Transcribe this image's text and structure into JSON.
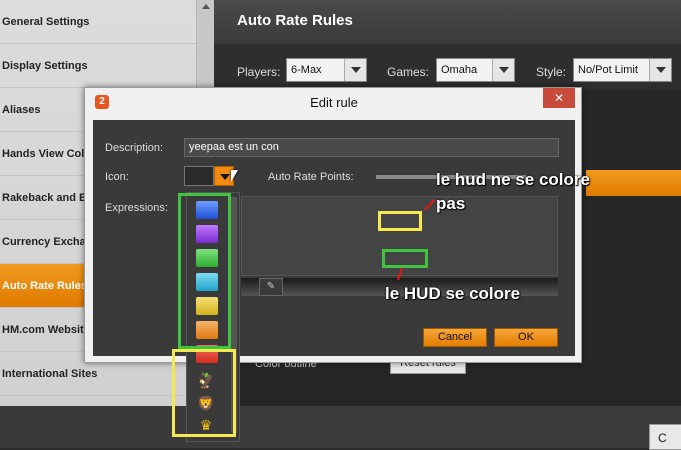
{
  "sidebar": {
    "items": [
      {
        "label": "General Settings"
      },
      {
        "label": "Display Settings"
      },
      {
        "label": "Aliases"
      },
      {
        "label": "Hands View Colu"
      },
      {
        "label": "Rakeback and Bo"
      },
      {
        "label": "Currency Exchang"
      },
      {
        "label": "Auto Rate Rules"
      },
      {
        "label": "HM.com Website"
      },
      {
        "label": "International Sites"
      }
    ],
    "active_index": 6
  },
  "main": {
    "title": "Auto Rate Rules",
    "filters": {
      "players_label": "Players:",
      "players_value": "6-Max",
      "games_label": "Games:",
      "games_value": "Omaha",
      "style_label": "Style:",
      "style_value": "No/Pot Limit"
    },
    "color_outline_label": "Color outline",
    "reset_button": "Reset rules",
    "bottom_button": "C"
  },
  "dialog": {
    "app_icon": "2",
    "title": "Edit rule",
    "close": "✕",
    "description_label": "Description:",
    "description_value": "yeepaa est un con",
    "icon_label": "Icon:",
    "auto_rate_label": "Auto Rate Points:",
    "expressions_label": "Expressions:",
    "cancel_label": "Cancel",
    "ok_label": "OK"
  },
  "icon_list": {
    "colors": [
      "#1e4fd6",
      "#7a2bd1",
      "#2fae2f",
      "#1fa3c9",
      "#d4b31a",
      "#e07a10",
      "#d42a1a"
    ],
    "images": [
      "eagle-icon",
      "lion-icon",
      "crown-icon"
    ]
  },
  "annotations": {
    "red_text_line1": "le hud ne se colore",
    "red_text_line2": "pas",
    "green_text": "le HUD se colore"
  },
  "colors": {
    "accent": "#e07a00",
    "highlight_green": "#3ec43e",
    "highlight_yellow": "#f4e94e"
  }
}
